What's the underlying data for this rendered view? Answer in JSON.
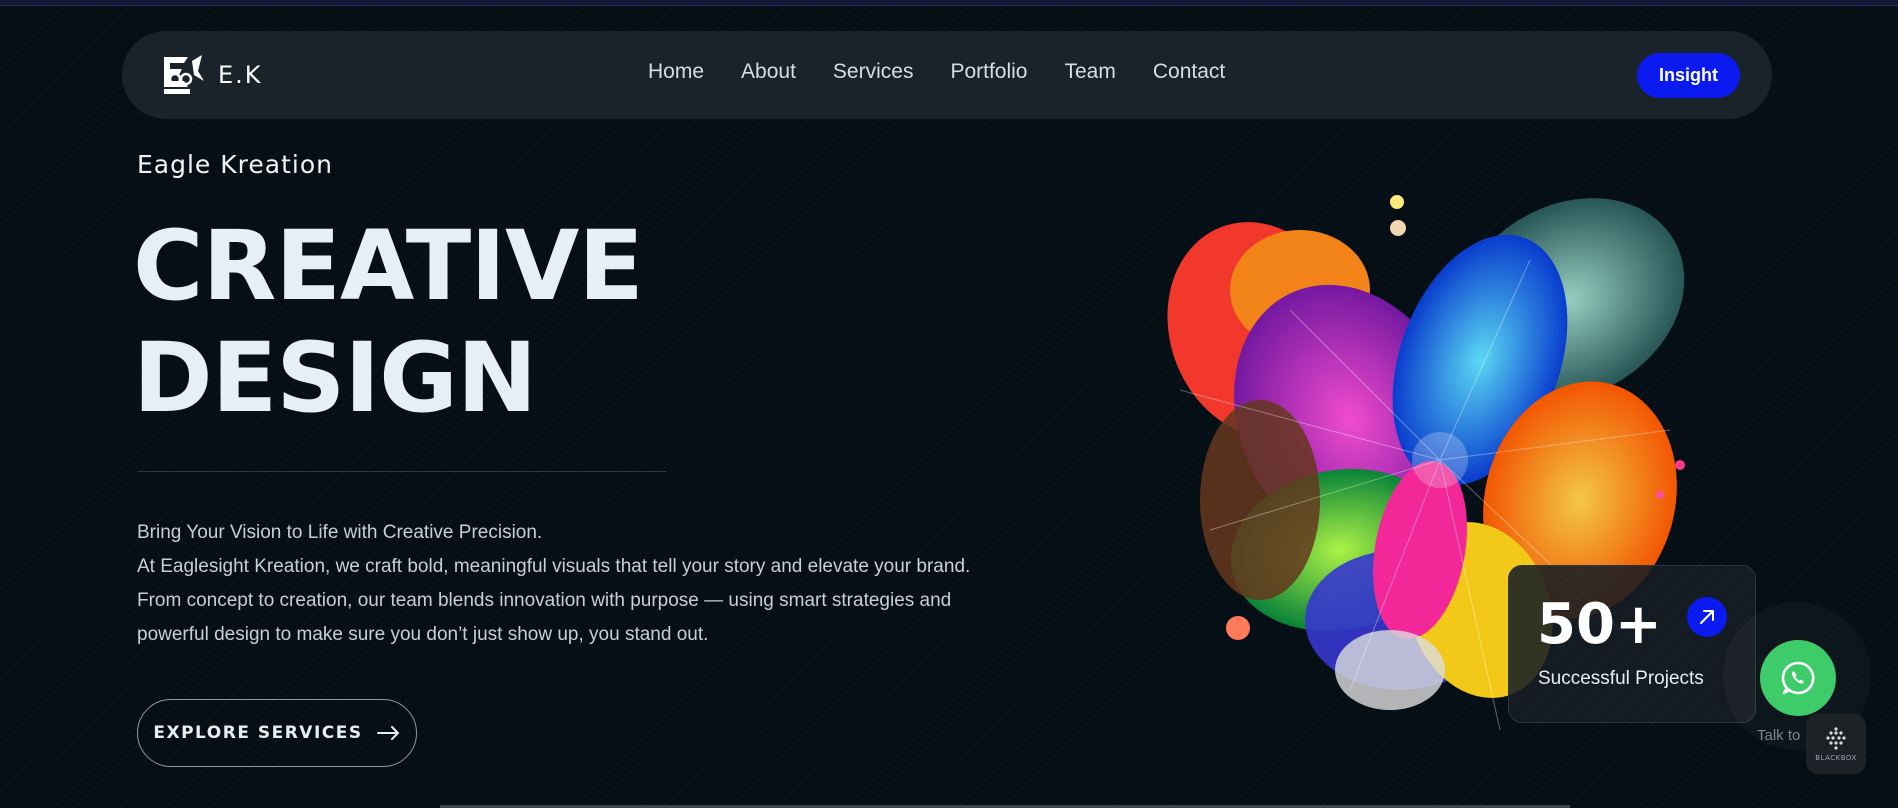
{
  "brand": {
    "logo_text": "E.K"
  },
  "nav": {
    "items": [
      {
        "label": "Home"
      },
      {
        "label": "About"
      },
      {
        "label": "Services"
      },
      {
        "label": "Portfolio"
      },
      {
        "label": "Team"
      },
      {
        "label": "Contact"
      }
    ],
    "cta_label": "Insight"
  },
  "hero": {
    "eyebrow": "Eagle Kreation",
    "headline_line1": "CREATIVE",
    "headline_line2": "DESIGN",
    "description": [
      "Bring Your Vision to Life with Creative Precision.",
      "At Eaglesight Kreation, we craft bold, meaningful visuals that tell your story and elevate your brand.",
      "From concept to creation, our team blends innovation with purpose — using smart strategies and",
      "powerful design to make sure you don’t just show up, you stand out."
    ],
    "cta_label": "EXPLORE SERVICES"
  },
  "stats": {
    "number": "50+",
    "label": "Successful Projects"
  },
  "chat": {
    "label": "Talk to",
    "badge_text": "BLACKBOX"
  },
  "colors": {
    "accent": "#0b1bf0",
    "whatsapp": "#3ecb6a",
    "background": "#060f15",
    "navbar": "#1a2329"
  }
}
